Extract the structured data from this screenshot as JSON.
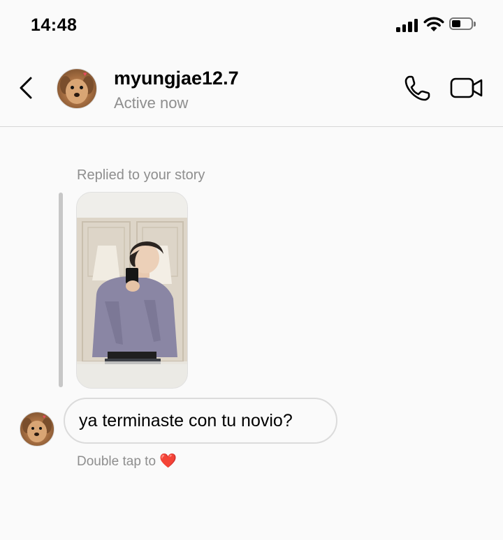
{
  "status_bar": {
    "time": "14:48",
    "battery_level": 0.45
  },
  "header": {
    "username": "myungjae12.7",
    "status": "Active now",
    "icons": [
      "back-arrow-icon",
      "phone-icon",
      "video-camera-icon"
    ]
  },
  "conversation": {
    "reply_label": "Replied to your story",
    "message_text": "ya terminaste con tu novio?",
    "hint_text": "Double tap to",
    "hint_heart": "❤️"
  },
  "colors": {
    "background": "#fafafa",
    "secondary_text": "#8e8e8e",
    "bubble_border": "#dbdbdb",
    "heart": "#e0245e"
  }
}
